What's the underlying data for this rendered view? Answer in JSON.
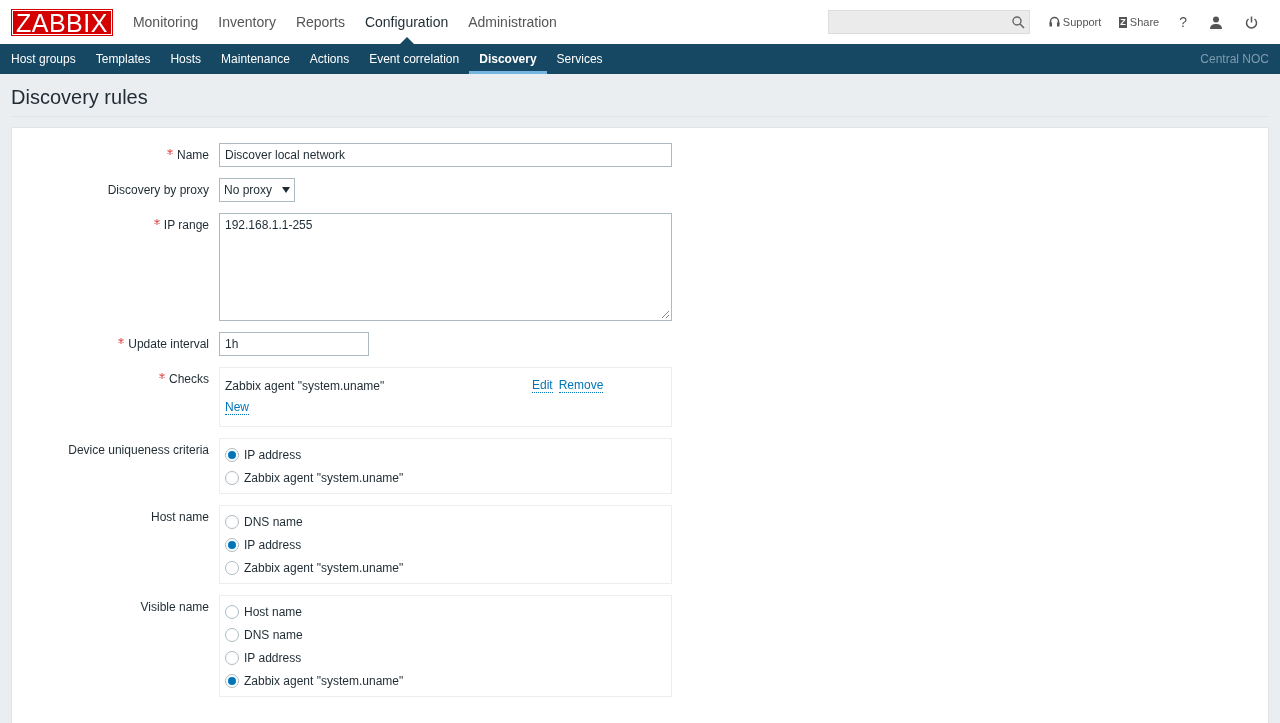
{
  "header": {
    "logo": "ZABBIX",
    "main_menu": [
      {
        "label": "Monitoring",
        "selected": false
      },
      {
        "label": "Inventory",
        "selected": false
      },
      {
        "label": "Reports",
        "selected": false
      },
      {
        "label": "Configuration",
        "selected": true
      },
      {
        "label": "Administration",
        "selected": false
      }
    ],
    "links": [
      {
        "kind": "support",
        "label": "Support"
      },
      {
        "kind": "share",
        "label": "Share",
        "badge": "Z"
      },
      {
        "kind": "help",
        "label": "?"
      },
      {
        "kind": "profile"
      },
      {
        "kind": "signout"
      }
    ]
  },
  "sub_menu": [
    {
      "label": "Host groups",
      "selected": false
    },
    {
      "label": "Templates",
      "selected": false
    },
    {
      "label": "Hosts",
      "selected": false
    },
    {
      "label": "Maintenance",
      "selected": false
    },
    {
      "label": "Actions",
      "selected": false
    },
    {
      "label": "Event correlation",
      "selected": false
    },
    {
      "label": "Discovery",
      "selected": true
    },
    {
      "label": "Services",
      "selected": false
    }
  ],
  "server_name": "Central NOC",
  "page_title": "Discovery rules",
  "form": [
    {
      "kind": "text",
      "label": "Name",
      "required": true,
      "value": "Discover local network"
    },
    {
      "kind": "select",
      "label": "Discovery by proxy",
      "required": false,
      "value": "No proxy"
    },
    {
      "kind": "textarea",
      "label": "IP range",
      "required": true,
      "value": "192.168.1.1-255"
    },
    {
      "kind": "short",
      "label": "Update interval",
      "required": true,
      "value": "1h"
    },
    {
      "kind": "checks",
      "label": "Checks",
      "required": true,
      "items": [
        {
          "name": "Zabbix agent \"system.uname\"",
          "actions": [
            "Edit",
            "Remove"
          ]
        }
      ],
      "add_link": "New"
    },
    {
      "kind": "radio",
      "label": "Device uniqueness criteria",
      "required": false,
      "options": [
        {
          "label": "IP address",
          "selected": true
        },
        {
          "label": "Zabbix agent \"system.uname\"",
          "selected": false
        }
      ]
    },
    {
      "kind": "radio",
      "label": "Host name",
      "required": false,
      "options": [
        {
          "label": "DNS name",
          "selected": false
        },
        {
          "label": "IP address",
          "selected": true
        },
        {
          "label": "Zabbix agent \"system.uname\"",
          "selected": false
        }
      ]
    },
    {
      "kind": "radio",
      "label": "Visible name",
      "required": false,
      "options": [
        {
          "label": "Host name",
          "selected": false
        },
        {
          "label": "DNS name",
          "selected": false
        },
        {
          "label": "IP address",
          "selected": false
        },
        {
          "label": "Zabbix agent \"system.uname\"",
          "selected": true
        }
      ]
    }
  ]
}
